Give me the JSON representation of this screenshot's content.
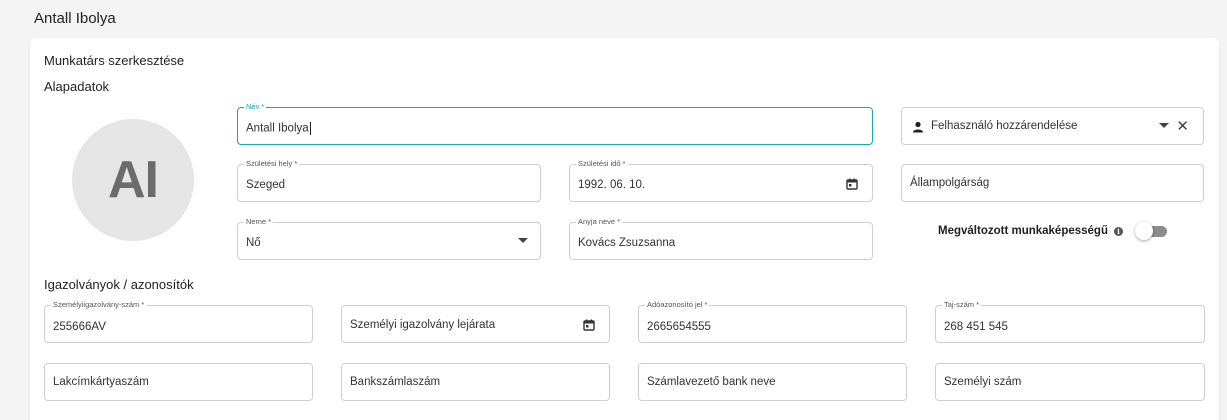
{
  "header": {
    "title": "Antall Ibolya"
  },
  "form": {
    "title": "Munkatárs szerkesztése",
    "section_basic": "Alapadatok",
    "section_ids": "Igazolványok / azonosítók",
    "avatar_initials": "AI",
    "name": {
      "label": "Név *",
      "value": "Antall Ibolya"
    },
    "user_assign": {
      "placeholder": "Felhasználó hozzárendelése",
      "icon": "person-icon"
    },
    "birth_place": {
      "label": "Születési hely *",
      "value": "Szeged"
    },
    "birth_date": {
      "label": "Születési idő *",
      "value": "1992. 06. 10.",
      "icon": "calendar-icon"
    },
    "citizenship": {
      "placeholder": "Állampolgárság"
    },
    "gender": {
      "label": "Neme *",
      "value": "Nő"
    },
    "mother_name": {
      "label": "Anyja neve *",
      "value": "Kovács Zsuzsanna"
    },
    "disability": {
      "label": "Megváltozott munkaképességű",
      "icon": "info-icon",
      "enabled": false
    },
    "id_card": {
      "label": "Személyiigazolvány-szám *",
      "value": "255666AV"
    },
    "id_expiry": {
      "placeholder": "Személyi igazolvány lejárata",
      "icon": "calendar-icon"
    },
    "tax_id": {
      "label": "Adóazonosító jel *",
      "value": "2665654555"
    },
    "taj": {
      "label": "Taj-szám *",
      "value": "268 451 545"
    },
    "address_card": {
      "placeholder": "Lakcímkártyaszám"
    },
    "bank_account": {
      "placeholder": "Bankszámlaszám"
    },
    "bank_name": {
      "placeholder": "Számlavezető bank neve"
    },
    "personal_number": {
      "placeholder": "Személyi szám"
    }
  },
  "colors": {
    "accent": "#1aa7a7",
    "toggle_off": "#8c8c8c",
    "avatar_bg": "#e5e5e5"
  }
}
